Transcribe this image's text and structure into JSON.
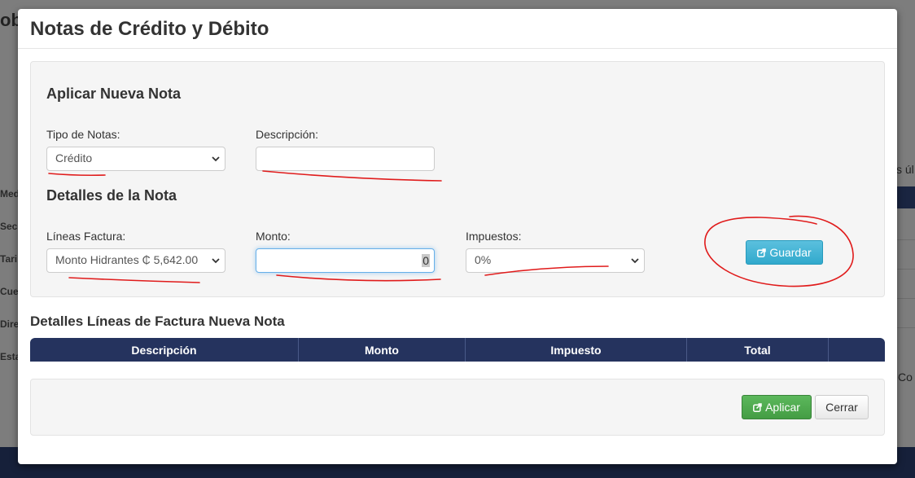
{
  "background": {
    "title_fragment": "ob",
    "side_items": [
      "Med",
      "Sec",
      "Tari",
      "Cue",
      "Dire",
      "Esta"
    ],
    "right_text_1": "s úl",
    "right_text_2": "Co"
  },
  "modal": {
    "title": "Notas de Crédito y Débito",
    "new_note": {
      "heading": "Aplicar Nueva Nota",
      "note_type": {
        "label": "Tipo de Notas:",
        "selected": "Crédito"
      },
      "description": {
        "label": "Descripción:",
        "value": ""
      }
    },
    "details": {
      "heading": "Detalles de la Nota",
      "invoice_lines": {
        "label": "Líneas Factura:",
        "selected": "Monto Hidrantes ₵ 5,642.00"
      },
      "amount": {
        "label": "Monto:",
        "value": "0"
      },
      "taxes": {
        "label": "Impuestos:",
        "selected": "0%"
      },
      "save_button": "Guardar"
    },
    "lines_table": {
      "heading": "Detalles Líneas de Factura Nueva Nota",
      "columns": [
        "Descripción",
        "Monto",
        "Impuesto",
        "Total",
        ""
      ]
    },
    "footer": {
      "apply_button": "Aplicar",
      "close_button": "Cerrar"
    }
  },
  "colors": {
    "annotation": "#e01b1b",
    "table_header": "#25335e",
    "save_button": "#31b0d5",
    "apply_button": "#5cb85c"
  },
  "icons": {
    "select_arrow": "chevron-down-icon",
    "save": "external-link-icon",
    "apply": "external-link-icon"
  }
}
